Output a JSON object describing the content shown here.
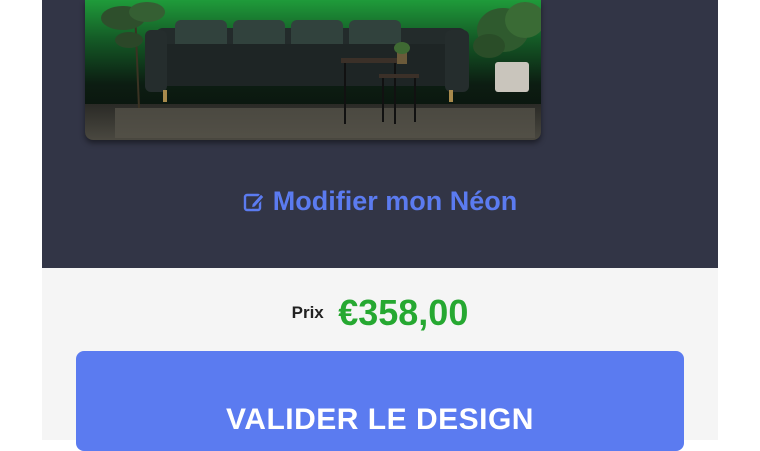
{
  "colors": {
    "dark_panel": "#323546",
    "light_panel": "#f5f5f5",
    "accent": "#5b7bf0",
    "price_green": "#26a831"
  },
  "preview": {
    "icon": "neon-sofa-scene-image"
  },
  "modify_link": {
    "icon": "edit-icon",
    "label": "Modifier mon Néon"
  },
  "price": {
    "label": "Prix",
    "value": "€358,00"
  },
  "cta": {
    "label": "VALIDER LE DESIGN"
  }
}
